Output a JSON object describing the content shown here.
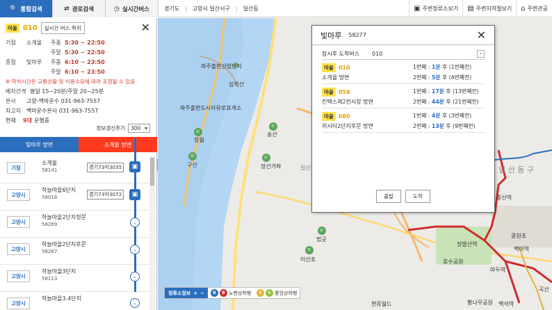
{
  "tabs": [
    {
      "label": "통합검색",
      "icon": "search-icon"
    },
    {
      "label": "경로검색",
      "icon": "route-icon"
    },
    {
      "label": "실시간버스",
      "icon": "clock-icon"
    }
  ],
  "breadcrumb": [
    "경기도",
    "고양시 일산서구",
    "일산동"
  ],
  "tools": [
    {
      "label": "주변정류소보기",
      "icon": "bus-stop-icon"
    },
    {
      "label": "주변지하철보기",
      "icon": "subway-icon"
    },
    {
      "label": "주변관공",
      "icon": "building-icon"
    }
  ],
  "route": {
    "badge": "마을",
    "number": "010",
    "realtime_button": "실시간 버스 위치",
    "first_label": "기점",
    "first_stop": "소개울",
    "last_label": "종점",
    "last_stop": "빛마루",
    "weekday": "주중",
    "weekend": "주말",
    "first_weekday": "5:30 ~ 22:50",
    "first_weekend": "5:30 ~ 22:50",
    "last_weekday": "6:10 ~ 23:50",
    "last_weekend": "6:10 ~ 23:50",
    "notice": "※ 막차시간은 교통상황 및 이용수요에 따라 조정될 수 있음",
    "interval_label": "배차간격",
    "interval": "평일 15~20분/주말 20~25분",
    "office_label": "본사",
    "office": "고양-백마운수 031-963-7557",
    "depot_label": "차고지",
    "depot": "백마운수본사 031-963-7557",
    "running_label": "현재",
    "running_count": "9대",
    "running_suffix": "운행중",
    "refresh_label": "정보갱신주기",
    "refresh_value": "300"
  },
  "directions": [
    "빛마루 방면",
    "소개울 방면"
  ],
  "stops": [
    {
      "area": "기점",
      "name": "소개울",
      "id": "58141",
      "plate": "경기73아3035"
    },
    {
      "area": "고양시",
      "name": "하늘마을6단지",
      "id": "58018",
      "plate": "경기73아3072"
    },
    {
      "area": "고양시",
      "name": "하늘마을2단지정문",
      "id": "58269",
      "plate": ""
    },
    {
      "area": "고양시",
      "name": "하늘마을2단지후문",
      "id": "58267",
      "plate": ""
    },
    {
      "area": "고양시",
      "name": "하늘마을3단지",
      "id": "58113",
      "plate": ""
    },
    {
      "area": "고양시",
      "name": "하늘마을3.4단지",
      "id": "",
      "plate": ""
    }
  ],
  "popup": {
    "name": "빛마루",
    "id": "58277",
    "soon_label": "잠시후 도착버스",
    "soon_value": "010",
    "arrivals": [
      {
        "badge": "마을",
        "no": "010",
        "dir": "소개울 방면",
        "first": "1번째 : ",
        "fmin": "1분",
        "frest": " 후 (1번째전)",
        "second": "2번째 : ",
        "smin": "5분",
        "srest": " 후 (4번째전)"
      },
      {
        "badge": "마을",
        "no": "058",
        "dir": "킨텍스제2전시장 방면",
        "first": "1번째 : ",
        "fmin": "17분",
        "frest": " 후 (13번째전)",
        "second": "2번째 : ",
        "smin": "44분",
        "srest": " 후 (21번째전)"
      },
      {
        "badge": "마을",
        "no": "080",
        "dir": "위시티2단지후문 방면",
        "first": "1번째 : ",
        "fmin": "4분",
        "frest": " 후 (3번째전)",
        "second": "2번째 : ",
        "smin": "13분",
        "srest": " 후 (9번째전)"
      }
    ],
    "depart": "출발",
    "arrive": "도착"
  },
  "map_labels": [
    "파주출판산업단지",
    "심학산",
    "파주출판도시자유로휴게소",
    "송산",
    "장월",
    "구산",
    "장산가좌",
    "일산",
    "일 산 동 구",
    "풍산역",
    "광원초",
    "백마역",
    "정발산역",
    "마두역",
    "호수공원",
    "법곳",
    "이산포",
    "현류월드",
    "황나무공원",
    "백석역",
    "곡산"
  ],
  "legend": {
    "title": "정류소정보",
    "plus": "+",
    "minus": "−",
    "item1": "노변상하행",
    "item2": "중앙상하행"
  }
}
